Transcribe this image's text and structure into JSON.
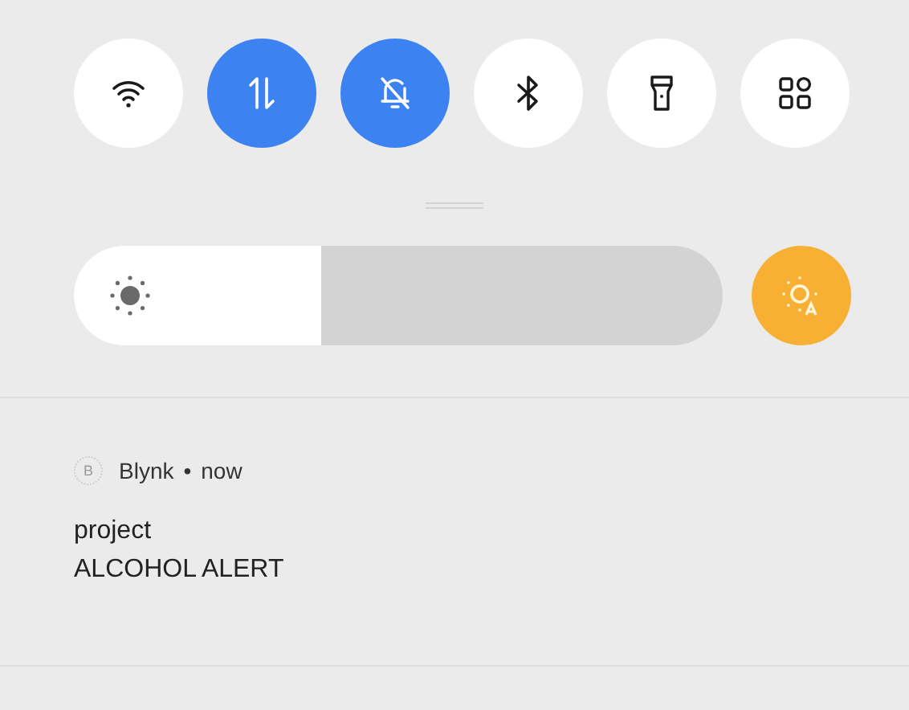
{
  "toggles": [
    {
      "kind": "wifi",
      "on": false
    },
    {
      "kind": "data",
      "on": true
    },
    {
      "kind": "mute",
      "on": true
    },
    {
      "kind": "bluetooth",
      "on": false
    },
    {
      "kind": "flashlight",
      "on": false
    },
    {
      "kind": "apps",
      "on": false
    }
  ],
  "brightness": {
    "level": 0.38,
    "auto": true
  },
  "notification": {
    "app_icon": "B",
    "app": "Blynk",
    "separator": "•",
    "time": "now",
    "title": "project",
    "body": "ALCOHOL ALERT"
  }
}
